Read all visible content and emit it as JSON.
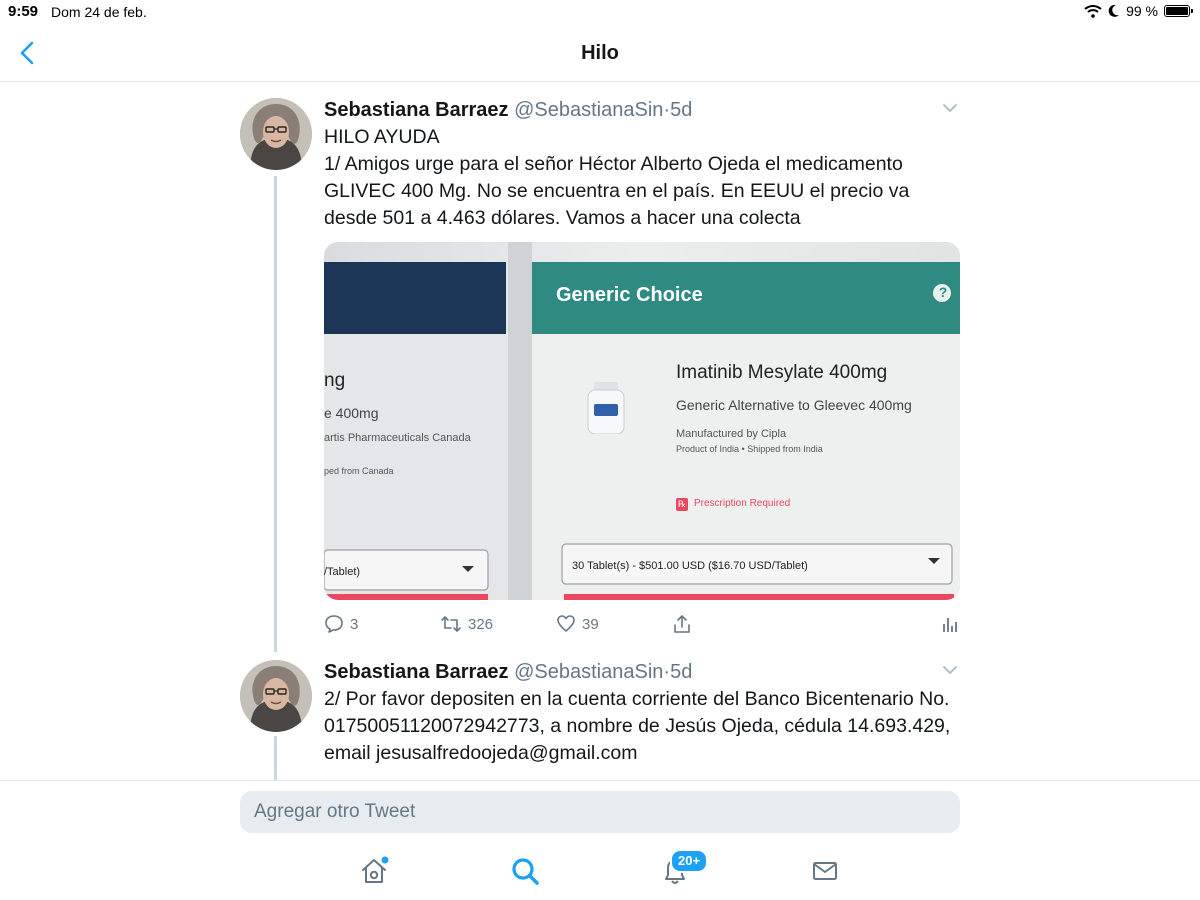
{
  "status_bar": {
    "time": "9:59",
    "date": "Dom 24 de feb.",
    "battery": "99 %",
    "battery_level": 0.99
  },
  "nav": {
    "title": "Hilo",
    "back_icon": "chevron-left-icon"
  },
  "tweets": [
    {
      "name": "Sebastiana Barraez",
      "handle": "@SebastianaSin",
      "separator": "·",
      "time": "5d",
      "text": [
        "HILO AYUDA",
        "1/ Amigos urge para el señor Héctor Alberto Ojeda el medicamento GLIVEC 400 Mg. No se encuentra en el país. En EEUU el precio va desde 501 a 4.463 dólares. Vamos a hacer una colecta"
      ],
      "media": {
        "header": "Generic Choice",
        "help": "?",
        "product_name": "Imatinib Mesylate 400mg",
        "product_alt": "Generic Alternative to Gleevec 400mg",
        "manufacturer": "Manufactured by Cipla",
        "origin": "Product of India • Shipped from India",
        "rx_icon": "℞",
        "prescription": "Prescription Required",
        "select_value": "30 Tablet(s) - $501.00 USD ($16.70 USD/Tablet)",
        "left_title": "ng",
        "left_dose": "e 400mg",
        "left_maker": "artis Pharmaceuticals Canada",
        "left_ship": "ped from Canada",
        "left_select": "/Tablet)"
      },
      "actions": {
        "replies": "3",
        "retweets": "326",
        "likes": "39"
      }
    },
    {
      "name": "Sebastiana Barraez",
      "handle": "@SebastianaSin",
      "separator": "·",
      "time": "5d",
      "text": [
        "2/ Por favor depositen en la cuenta corriente del Banco Bicentenario No. 01750051120072942773, a nombre de Jesús Ojeda, cédula 14.693.429, email jesusalfredoojeda@gmail.com"
      ]
    }
  ],
  "compose": {
    "placeholder": "Agregar otro Tweet"
  },
  "tab_bar": {
    "notifications_badge": "20+",
    "accent": "#1da1f2",
    "tabs": [
      "home-icon",
      "search-icon",
      "bell-icon",
      "mail-icon"
    ]
  }
}
